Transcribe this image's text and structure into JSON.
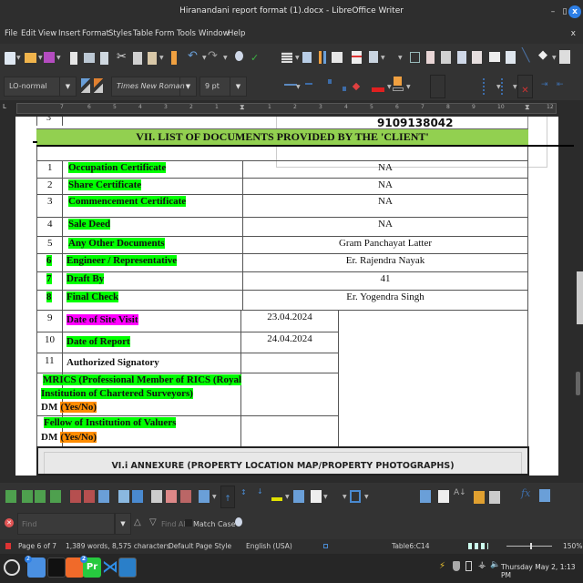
{
  "window": {
    "title": "Hiranandani report format (1).docx - LibreOffice Writer",
    "minimize_label": "–",
    "maximize_label": "▯",
    "close_label": "x"
  },
  "menubar": {
    "items": [
      "File",
      "Edit",
      "View",
      "Insert",
      "Format",
      "Styles",
      "Table",
      "Form",
      "Tools",
      "Window",
      "Help"
    ],
    "doc_close_label": "x"
  },
  "formatting": {
    "paragraph_style": "LO-normal",
    "font_name": "Times New Roman",
    "font_size": "9 pt"
  },
  "ruler": {
    "labels": [
      "1",
      "2",
      "3",
      "4",
      "5",
      "6",
      "7",
      "8",
      "9",
      "10",
      "11",
      "12"
    ],
    "left_labels": [
      "7",
      "6",
      "5",
      "4",
      "3",
      "2",
      "1"
    ]
  },
  "document": {
    "prev_row_number": "3",
    "prev_row_value": "9109138042",
    "section_heading": "VII. LIST OF DOCUMENTS PROVIDED BY THE 'CLIENT'",
    "rows": [
      {
        "no": "1",
        "label": "Occupation Certificate",
        "value": "NA",
        "highlight": "green",
        "no_highlight": "none"
      },
      {
        "no": "2",
        "label": "Share Certificate",
        "value": "NA",
        "highlight": "green",
        "no_highlight": "none"
      },
      {
        "no": "3",
        "label": "Commencement Certificate",
        "value": "NA",
        "highlight": "green",
        "no_highlight": "none"
      },
      {
        "no": "4",
        "label": "Sale Deed",
        "value": "NA",
        "highlight": "green",
        "no_highlight": "none"
      },
      {
        "no": "5",
        "label": "Any Other Documents",
        "value": "Gram Panchayat Latter",
        "highlight": "green",
        "no_highlight": "none"
      },
      {
        "no": "6",
        "label": "Engineer / Representative",
        "value": "Er. Rajendra Nayak",
        "highlight": "green",
        "no_highlight": "green"
      },
      {
        "no": "7",
        "label": "Draft By",
        "value": "41",
        "highlight": "green",
        "no_highlight": "green"
      },
      {
        "no": "8",
        "label": "Final Check",
        "value": "Er. Yogendra Singh",
        "highlight": "green",
        "no_highlight": "green"
      }
    ],
    "date_rows": [
      {
        "no": "9",
        "label": "Date of Site Visit",
        "value": "23.04.2024",
        "highlight": "magenta"
      },
      {
        "no": "10",
        "label": "Date of Report",
        "value": "24.04.2024",
        "highlight": "green"
      },
      {
        "no": "11",
        "label": "Authorized Signatory",
        "value": "",
        "highlight": "none"
      }
    ],
    "mrics_line1": "MRICS (Professional Member of RICS (Royal",
    "mrics_line2": "Institution of Chartered Surveyors)",
    "dm_label": "DM",
    "yes_no": "(Yes/No)",
    "fellow_label": "Fellow of Institution of Valuers",
    "annexure_heading": "VI.i ANNEXURE (PROPERTY LOCATION MAP/PROPERTY PHOTOGRAPHS)"
  },
  "findbar": {
    "placeholder": "Find",
    "find_all_label": "Find All",
    "match_case_label": "Match Case"
  },
  "statusbar": {
    "page": "Page 6 of 7",
    "word_count": "1,389 words, 8,575 characters",
    "page_style": "Default Page Style",
    "language": "English (USA)",
    "table_cell": "Table6:C14",
    "zoom": "150%"
  },
  "taskbar": {
    "clock": "Thursday May 2, 1:13 PM",
    "files_badge": "2",
    "premiere_badge": "2",
    "premiere_label": "Pr"
  },
  "colors": {
    "heading_bg": "#92d050",
    "highlight_green": "#00ff00",
    "highlight_magenta": "#ff00ff",
    "highlight_orange": "#ff8c00",
    "accent_blue": "#2d7fe6"
  }
}
